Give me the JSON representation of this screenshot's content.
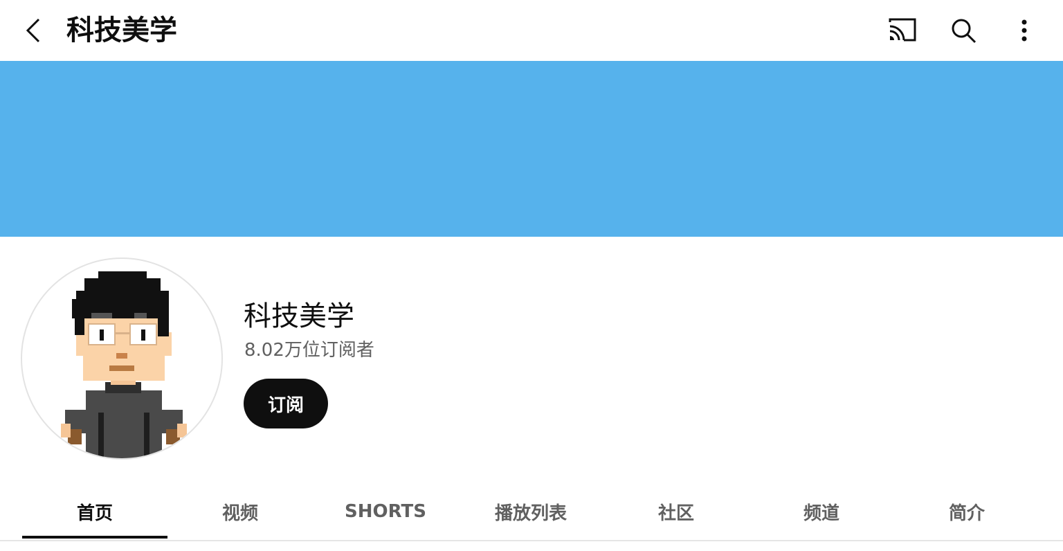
{
  "header": {
    "title": "科技美学",
    "icons": [
      "chevron-left-icon",
      "cast-icon",
      "search-icon",
      "more-vert-icon"
    ]
  },
  "colors": {
    "banner": "#56b2ec",
    "text_primary": "#0f0f0f",
    "text_secondary": "#606060",
    "subscribe_bg": "#0f0f0f"
  },
  "channel": {
    "name": "科技美学",
    "subscribers": "8.02万位订阅者",
    "subscribe_label": "订阅"
  },
  "tabs": [
    {
      "label": "首页",
      "active": true
    },
    {
      "label": "视频",
      "active": false
    },
    {
      "label": "SHORTS",
      "active": false
    },
    {
      "label": "播放列表",
      "active": false
    },
    {
      "label": "社区",
      "active": false
    },
    {
      "label": "频道",
      "active": false
    },
    {
      "label": "简介",
      "active": false
    }
  ]
}
